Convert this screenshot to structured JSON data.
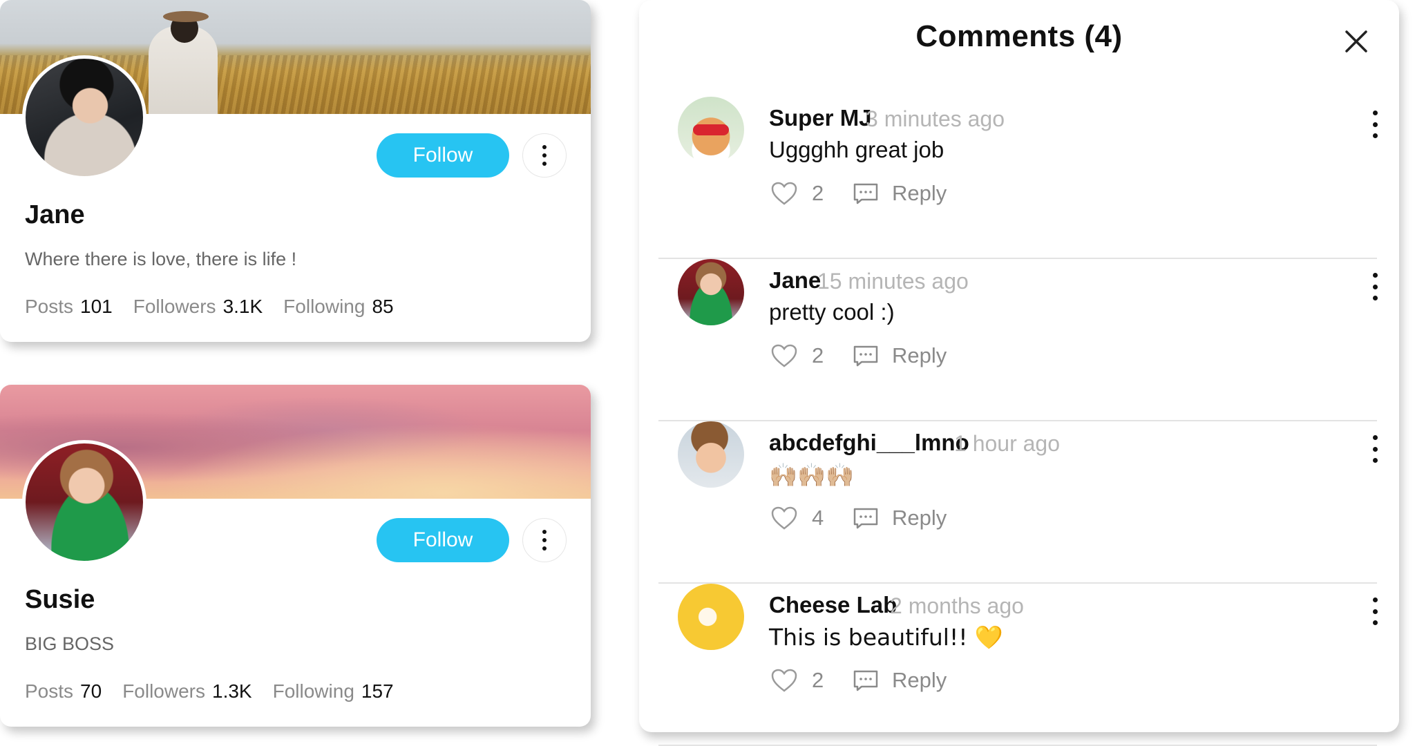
{
  "profiles": [
    {
      "name": "Jane",
      "bio": "Where there is love, there is life !",
      "follow_label": "Follow",
      "stats": [
        {
          "label": "Posts",
          "value": "101"
        },
        {
          "label": "Followers",
          "value": "3.1K"
        },
        {
          "label": "Following",
          "value": "85"
        }
      ],
      "cover_icon": "wheat-field-photo",
      "avatar_icon": "jane-photo"
    },
    {
      "name": "Susie",
      "bio": "BIG BOSS",
      "follow_label": "Follow",
      "stats": [
        {
          "label": "Posts",
          "value": "70"
        },
        {
          "label": "Followers",
          "value": "1.3K"
        },
        {
          "label": "Following",
          "value": "157"
        }
      ],
      "cover_icon": "pink-sunset-clouds-photo",
      "avatar_icon": "susie-photo"
    }
  ],
  "comments_panel": {
    "title": "Comments (4)",
    "close_icon": "close-icon",
    "reply_label": "Reply",
    "comments": [
      {
        "author": "Super MJ",
        "time": "3 minutes ago",
        "text": "Uggghh great job",
        "likes": "2",
        "avatar_icon": "dog-with-sunglasses-avatar"
      },
      {
        "author": "Jane",
        "time": "15 minutes ago",
        "text": "pretty cool :)",
        "likes": "2",
        "avatar_icon": "jane-avatar"
      },
      {
        "author": "abcdefghi___lmno",
        "time": "1 hour ago",
        "text": "🙌🏼🙌🏼🙌🏼",
        "likes": "4",
        "avatar_icon": "smiling-boy-avatar"
      },
      {
        "author": "Cheese Lab",
        "time": "2 months ago",
        "text": "This is beautiful!! 💛",
        "likes": "2",
        "avatar_icon": "cheese-mouse-avatar"
      }
    ]
  },
  "colors": {
    "accent": "#27c4f2",
    "muted_text": "#8a8a8a",
    "timestamp": "#b5b5b5",
    "divider": "#e3e3e3"
  }
}
